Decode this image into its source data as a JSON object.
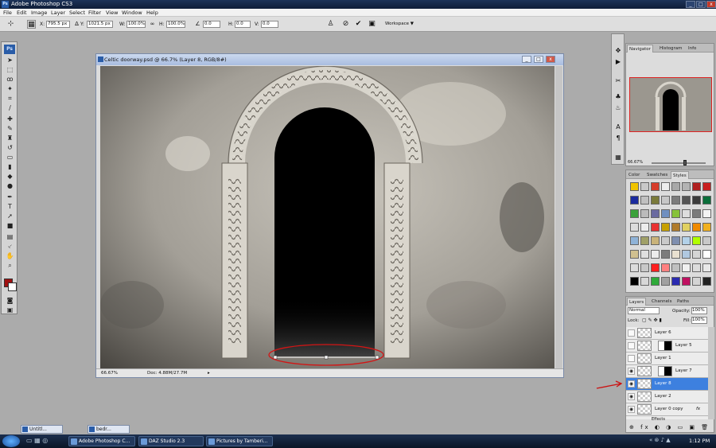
{
  "app": {
    "title": "Adobe Photoshop CS3",
    "icon": "ps-icon"
  },
  "menu": [
    "File",
    "Edit",
    "Image",
    "Layer",
    "Select",
    "Filter",
    "View",
    "Window",
    "Help"
  ],
  "options": {
    "x_label": "X:",
    "x_value": "795.5 px",
    "y_label": "Y:",
    "y_value": "1021.5 px",
    "w_label": "W:",
    "w_value": "100.0%",
    "h_label": "H:",
    "h_value": "100.0%",
    "angle_value": "0.0",
    "hskew_label": "H:",
    "hskew_value": "0.0",
    "vskew_label": "V:",
    "vskew_value": "0.0",
    "workspace_label": "Workspace ▼"
  },
  "toolbox": {
    "logo": "Ps",
    "fg_color": "#a01010",
    "bg_color": "#ffffff"
  },
  "document": {
    "title": "Celtic doorway.psd @ 66.7% (Layer 8, RGB/8#)",
    "zoom": "66.67%",
    "doc_info": "Doc: 4.88M/27.7M"
  },
  "navigator": {
    "tabs": [
      "Navigator",
      "Histogram",
      "Info"
    ],
    "zoom": "66.67%",
    "zoom_level": 0.62
  },
  "styles_panel": {
    "tabs": [
      "Color",
      "Swatches",
      "Styles"
    ],
    "swatches": [
      "#f0c400",
      "#c9c9c9",
      "#d63c2a",
      "#ededed",
      "#a8a8a8",
      "#b3b3b3",
      "#b02020",
      "#c82020",
      "#1a2a9e",
      "#c0c0c0",
      "#7a7a3a",
      "#c7c7c7",
      "#7c7c7c",
      "#555555",
      "#3b3b3b",
      "#0a6e3a",
      "#3aa13a",
      "#bbbbbb",
      "#6a6aa0",
      "#6f8fc0",
      "#87c23a",
      "#ddd",
      "#7a7a7a",
      "#f3f3f3",
      "#dcdcdc",
      "#ececec",
      "#e83030",
      "#c7a000",
      "#b07b2a",
      "#e0d060",
      "#ef8a00",
      "#f0b020",
      "#8fb3d8",
      "#a0a068",
      "#c9b37a",
      "#c9c9c9",
      "#7f8fb0",
      "#b3d1e8",
      "#b1ff00",
      "#c8c8c8",
      "#d0c090",
      "#e0e0e0",
      "#ececec",
      "#7c7c7c",
      "#e9e0d0",
      "#b0c8e0",
      "#d5d5d5",
      "#ffffff",
      "#dcdcdc",
      "#c8c8c8",
      "#ff2020",
      "#ff8080",
      "#c0c0c0",
      "#f0f0f0",
      "#dcdcdc",
      "#e8e8e8",
      "#000000",
      "#d7d7d7",
      "#2faa3a",
      "#a0a0a0",
      "#2a2ab0",
      "#c01060",
      "#d4d4d4",
      "#222222"
    ]
  },
  "layers_panel": {
    "tabs": [
      "Layers",
      "Channels",
      "Paths"
    ],
    "blend_mode": "Normal",
    "opacity_label": "Opacity:",
    "opacity_value": "100%",
    "lock_label": "Lock:",
    "fill_label": "Fill:",
    "fill_value": "100%",
    "layers": [
      {
        "name": "Layer 6",
        "visible": false,
        "mask": false,
        "selected": false
      },
      {
        "name": "Layer 5",
        "visible": false,
        "mask": true,
        "selected": false
      },
      {
        "name": "Layer 1",
        "visible": false,
        "mask": false,
        "selected": false
      },
      {
        "name": "Layer 7",
        "visible": true,
        "mask": true,
        "selected": false
      },
      {
        "name": "Layer 8",
        "visible": true,
        "mask": false,
        "selected": true
      },
      {
        "name": "Layer 2",
        "visible": true,
        "mask": false,
        "selected": false
      },
      {
        "name": "Layer 0 copy",
        "visible": true,
        "mask": false,
        "selected": false,
        "fx": "fx"
      }
    ],
    "effects_label": "Effects"
  },
  "minimized": [
    {
      "label": "Untitl..."
    },
    {
      "label": "bedr..."
    }
  ],
  "taskbar": {
    "items": [
      "Adobe Photoshop C...",
      "DAZ Studio 2.3",
      "Pictures by Tamberi..."
    ],
    "clock": "1:12 PM"
  }
}
